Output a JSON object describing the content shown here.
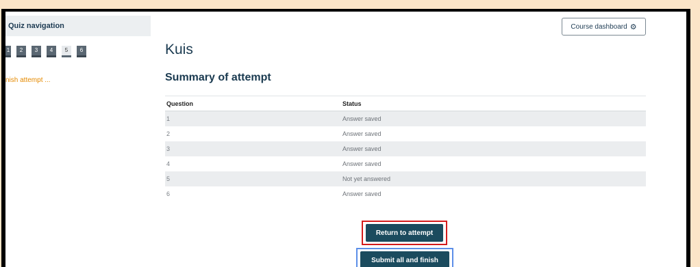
{
  "sidebar": {
    "header": "Quiz navigation",
    "questions": [
      {
        "label": "1",
        "state": "answered"
      },
      {
        "label": "2",
        "state": "answered"
      },
      {
        "label": "3",
        "state": "answered"
      },
      {
        "label": "4",
        "state": "answered"
      },
      {
        "label": "5",
        "state": "unanswered"
      },
      {
        "label": "6",
        "state": "answered"
      }
    ],
    "finish_link": "nish attempt ..."
  },
  "header": {
    "dashboard_button": "Course dashboard",
    "dashboard_icon": "gear-icon"
  },
  "main": {
    "title": "Kuis",
    "subtitle": "Summary of attempt",
    "table": {
      "columns": [
        "Question",
        "Status"
      ],
      "rows": [
        {
          "question": "1",
          "status": "Answer saved"
        },
        {
          "question": "2",
          "status": "Answer saved"
        },
        {
          "question": "3",
          "status": "Answer saved"
        },
        {
          "question": "4",
          "status": "Answer saved"
        },
        {
          "question": "5",
          "status": "Not yet answered"
        },
        {
          "question": "6",
          "status": "Answer saved"
        }
      ]
    },
    "return_button": "Return to attempt",
    "submit_button": "Submit all and finish"
  },
  "colors": {
    "primary_button": "#1b4b5e",
    "link_orange": "#e58a00",
    "highlight_red": "#d41b1b",
    "highlight_blue": "#5b8ee8"
  }
}
